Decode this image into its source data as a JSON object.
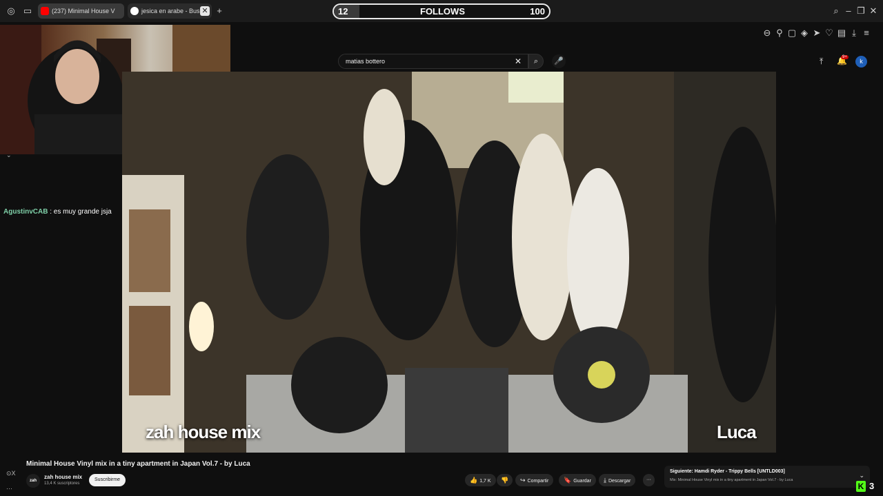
{
  "browser": {
    "tabs": [
      {
        "label": "(237) Minimal House V",
        "favicon_color": "#ff0000"
      },
      {
        "label": "jesica en arabe - Busc",
        "favicon_color": "#4285f4"
      }
    ],
    "new_tab_icon": "plus-icon"
  },
  "follows_goal": {
    "current": "12",
    "label": "FOLLOWS",
    "target": "100",
    "progress": 0.12
  },
  "youtube": {
    "search_value": "matias bottero",
    "notification_count": "9+",
    "account_initial": "k"
  },
  "chat": {
    "user": "AgustinvCAB",
    "message": ": es muy grande jsja"
  },
  "video": {
    "caption_left": "zah house mix",
    "caption_right": "Luca",
    "title": "Minimal House Vinyl mix in a tiny apartment in Japan Vol.7 - by Luca",
    "channel": {
      "name": "zah house mix",
      "subscribers": "13,4 K suscriptores",
      "avatar_text": "zah"
    },
    "subscribe_label": "Suscribirme",
    "actions": {
      "likes": "1,7 K",
      "share": "Compartir",
      "save": "Guardar",
      "download": "Descargar",
      "more": "···"
    }
  },
  "next_up": {
    "title": "Siguiente: Hamdi Ryder - Trippy Bells [UNTLD003]",
    "subtitle": "Mix: Minimal House Vinyl mix in a tiny apartment in Japan Vol.7 - by Luca"
  },
  "kick": {
    "logo": "K",
    "count": "3"
  },
  "sidebar": {
    "label_top": "⊙X",
    "label_bottom": "···"
  }
}
